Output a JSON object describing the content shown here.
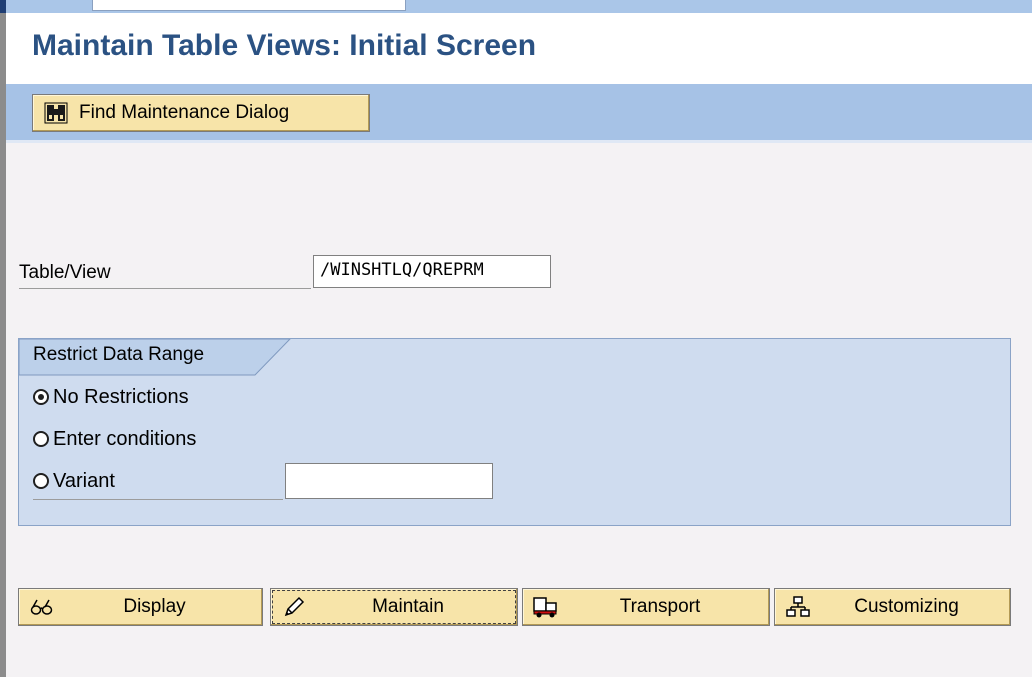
{
  "window": {
    "title": "Maintain Table Views: Initial Screen"
  },
  "toolbar": {
    "find_dialog_label": "Find Maintenance Dialog",
    "find_dialog_icon": "binoculars-icon"
  },
  "form": {
    "table_view_label": "Table/View",
    "table_view_value": "/WINSHTLQ/QREPRM"
  },
  "restrict_group": {
    "title": "Restrict Data Range",
    "options": [
      {
        "label": "No Restrictions",
        "selected": true
      },
      {
        "label": "Enter conditions",
        "selected": false
      },
      {
        "label": "Variant",
        "selected": false
      }
    ],
    "variant_value": ""
  },
  "actions": {
    "display_label": "Display",
    "display_icon": "glasses-icon",
    "maintain_label": "Maintain",
    "maintain_icon": "pencil-icon",
    "transport_label": "Transport",
    "transport_icon": "truck-icon",
    "customizing_label": "Customizing",
    "customizing_icon": "hierarchy-icon"
  },
  "colors": {
    "title_text": "#2b5283",
    "toolbar_bg": "#a6c2e6",
    "button_bg": "#f7e4a9",
    "group_bg": "#cfdcef",
    "page_bg": "#f4f2f4"
  }
}
